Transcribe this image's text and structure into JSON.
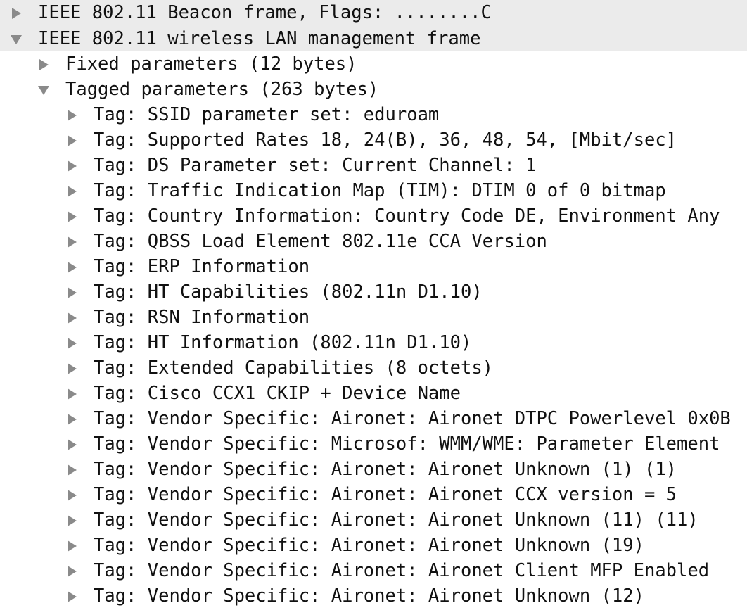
{
  "colors": {
    "header_background": "#ebebeb",
    "text": "#111111",
    "triangle": "#8a8a8a"
  },
  "tree": [
    {
      "label": "IEEE 802.11 Beacon frame, Flags: ........C",
      "level": 0,
      "expanded": false
    },
    {
      "label": "IEEE 802.11 wireless LAN management frame",
      "level": 0,
      "expanded": true
    },
    {
      "label": "Fixed parameters (12 bytes)",
      "level": 1,
      "expanded": false
    },
    {
      "label": "Tagged parameters (263 bytes)",
      "level": 1,
      "expanded": true
    },
    {
      "label": "Tag: SSID parameter set: eduroam",
      "level": 2,
      "expanded": false
    },
    {
      "label": "Tag: Supported Rates 18, 24(B), 36, 48, 54, [Mbit/sec]",
      "level": 2,
      "expanded": false
    },
    {
      "label": "Tag: DS Parameter set: Current Channel: 1",
      "level": 2,
      "expanded": false
    },
    {
      "label": "Tag: Traffic Indication Map (TIM): DTIM 0 of 0 bitmap",
      "level": 2,
      "expanded": false
    },
    {
      "label": "Tag: Country Information: Country Code DE, Environment Any",
      "level": 2,
      "expanded": false
    },
    {
      "label": "Tag: QBSS Load Element 802.11e CCA Version",
      "level": 2,
      "expanded": false
    },
    {
      "label": "Tag: ERP Information",
      "level": 2,
      "expanded": false
    },
    {
      "label": "Tag: HT Capabilities (802.11n D1.10)",
      "level": 2,
      "expanded": false
    },
    {
      "label": "Tag: RSN Information",
      "level": 2,
      "expanded": false
    },
    {
      "label": "Tag: HT Information (802.11n D1.10)",
      "level": 2,
      "expanded": false
    },
    {
      "label": "Tag: Extended Capabilities (8 octets)",
      "level": 2,
      "expanded": false
    },
    {
      "label": "Tag: Cisco CCX1 CKIP + Device Name",
      "level": 2,
      "expanded": false
    },
    {
      "label": "Tag: Vendor Specific: Aironet: Aironet DTPC Powerlevel 0x0B",
      "level": 2,
      "expanded": false
    },
    {
      "label": "Tag: Vendor Specific: Microsof: WMM/WME: Parameter Element",
      "level": 2,
      "expanded": false
    },
    {
      "label": "Tag: Vendor Specific: Aironet: Aironet Unknown (1) (1)",
      "level": 2,
      "expanded": false
    },
    {
      "label": "Tag: Vendor Specific: Aironet: Aironet CCX version = 5",
      "level": 2,
      "expanded": false
    },
    {
      "label": "Tag: Vendor Specific: Aironet: Aironet Unknown (11) (11)",
      "level": 2,
      "expanded": false
    },
    {
      "label": "Tag: Vendor Specific: Aironet: Aironet Unknown (19)",
      "level": 2,
      "expanded": false
    },
    {
      "label": "Tag: Vendor Specific: Aironet: Aironet Client MFP Enabled",
      "level": 2,
      "expanded": false
    },
    {
      "label": "Tag: Vendor Specific: Aironet: Aironet Unknown (12)",
      "level": 2,
      "expanded": false
    }
  ]
}
